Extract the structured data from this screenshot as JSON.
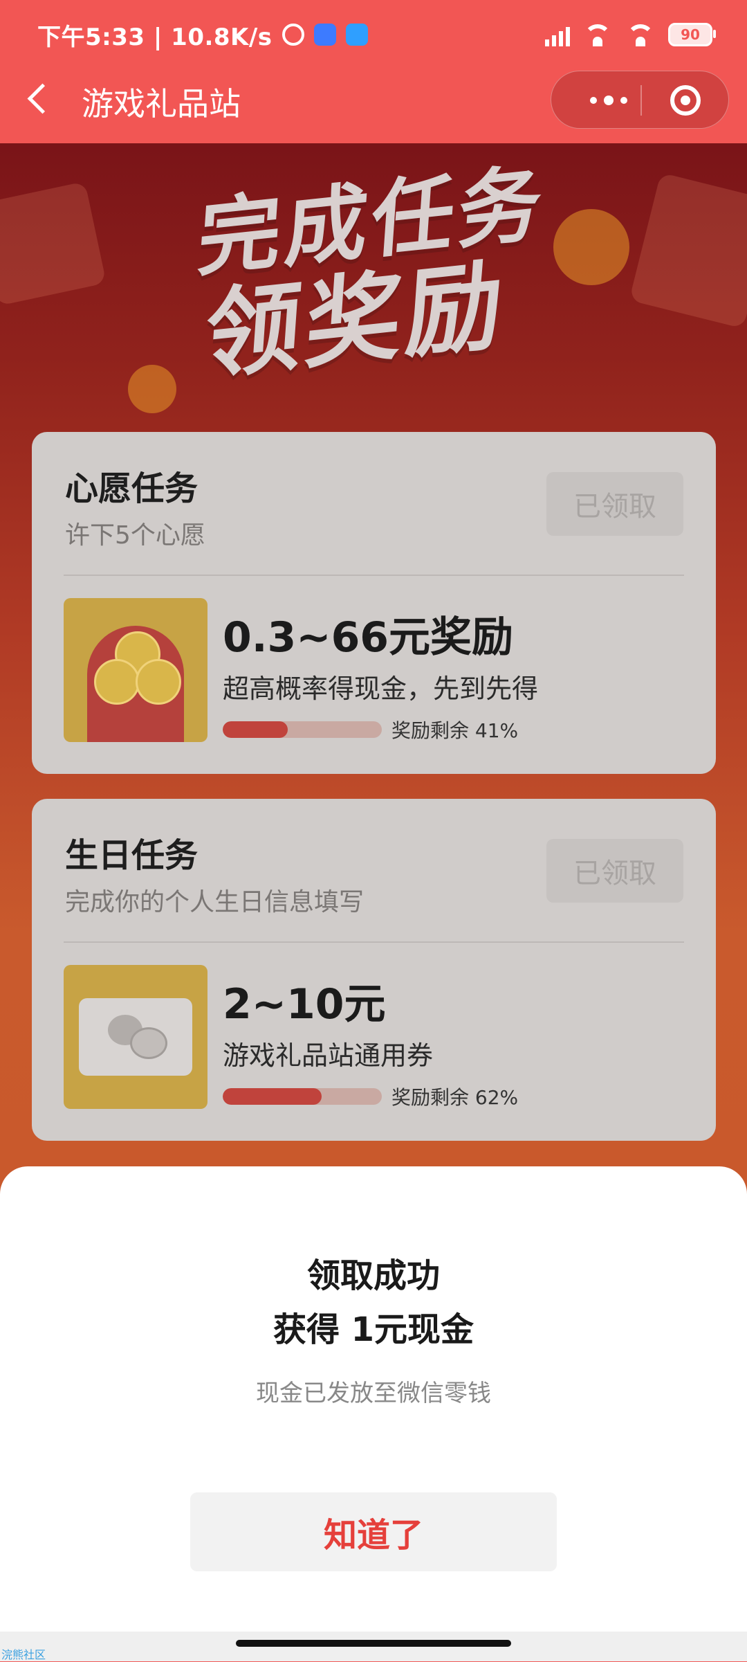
{
  "status_bar": {
    "time_net": "下午5:33 | 10.8K/s",
    "battery": "90"
  },
  "nav": {
    "title": "游戏礼品站"
  },
  "hero": {
    "line1": "完成任务",
    "line2": "领奖励"
  },
  "tasks": [
    {
      "title": "心愿任务",
      "subtitle": "许下5个心愿",
      "button": "已领取",
      "reward_amount": "0.3~66元奖励",
      "reward_desc": "超高概率得现金，先到先得",
      "remaining_label": "奖励剩余 41%",
      "remaining_fraction": 0.41
    },
    {
      "title": "生日任务",
      "subtitle": "完成你的个人生日信息填写",
      "button": "已领取",
      "reward_amount": "2~10元",
      "reward_desc": "游戏礼品站通用券",
      "remaining_label": "奖励剩余 62%",
      "remaining_fraction": 0.62
    }
  ],
  "modal": {
    "title_line1": "领取成功",
    "title_line2": "获得 1元现金",
    "message": "现金已发放至微信零钱",
    "confirm_button": "知道了"
  },
  "watermark": "浣熊社区",
  "colors": {
    "brand_red": "#f25654",
    "confirm_text": "#e5403b"
  }
}
